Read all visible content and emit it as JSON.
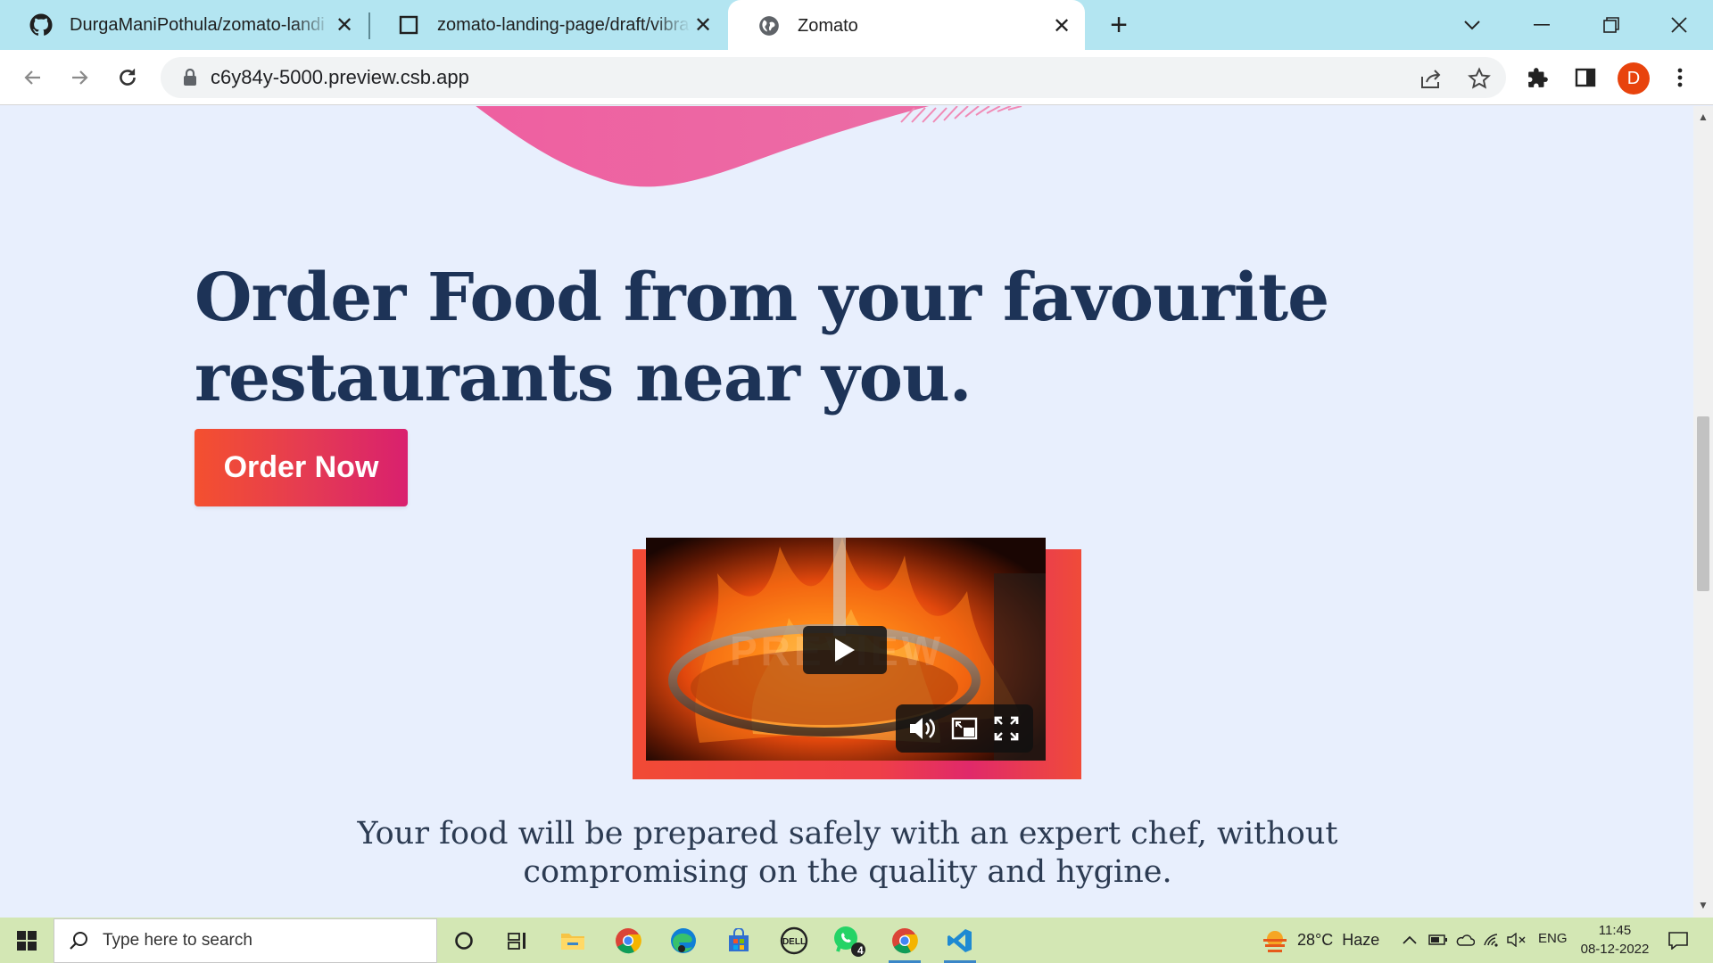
{
  "browser": {
    "tabs": [
      {
        "title": "DurgaManiPothula/zomato-landi",
        "icon": "github-icon"
      },
      {
        "title": "zomato-landing-page/draft/vibra",
        "icon": "codesandbox-icon"
      },
      {
        "title": "Zomato",
        "icon": "globe-icon",
        "active": true
      }
    ],
    "address": "c6y84y-5000.preview.csb.app",
    "profile_initial": "D"
  },
  "page": {
    "headline_line1": "Order Food from your favourite",
    "headline_line2": "restaurants near you.",
    "cta_label": "Order Now",
    "video_watermark": "PREVIEW",
    "subtext_line1": "Your food will be prepared safely with an expert chef, without",
    "subtext_line2": "compromising on the quality and hygine."
  },
  "taskbar": {
    "search_placeholder": "Type here to search",
    "whatsapp_badge": "4",
    "weather_temp": "28°C",
    "weather_desc": "Haze",
    "lang": "ENG",
    "time": "11:45",
    "date": "08-12-2022"
  },
  "colors": {
    "page_bg": "#e8effd",
    "headline": "#1d3357",
    "cta_start": "#f4502f",
    "cta_end": "#d9206e",
    "tabstrip": "#b3e5f1",
    "taskbar": "#d3e7b4"
  }
}
